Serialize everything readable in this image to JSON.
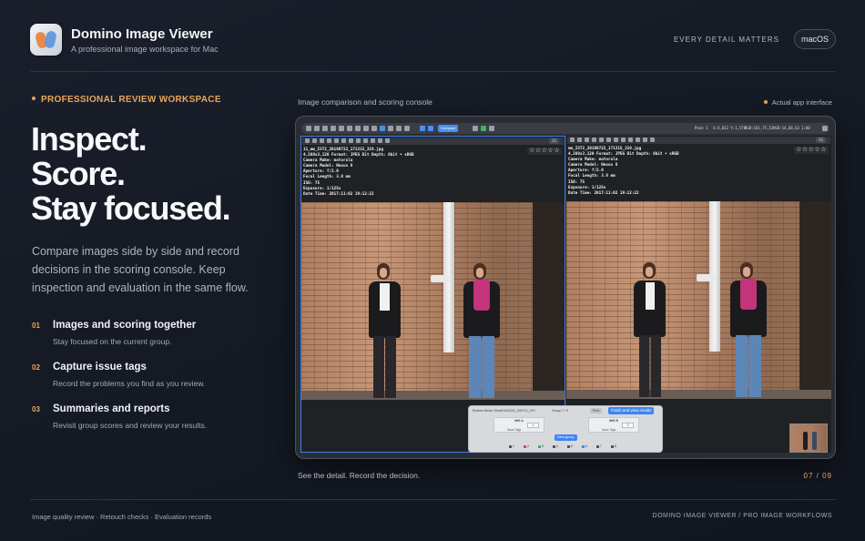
{
  "header": {
    "app_title": "Domino Image Viewer",
    "app_subtitle": "A professional image workspace for Mac",
    "tagline": "EVERY DETAIL MATTERS",
    "os_badge": "macOS"
  },
  "hero": {
    "eyebrow": "PROFESSIONAL REVIEW WORKSPACE",
    "lines": [
      "Inspect.",
      "Score.",
      "Stay focused."
    ],
    "lede": "Compare images side by side and record decisions in the scoring console. Keep inspection and evaluation in the same flow."
  },
  "features": [
    {
      "num": "01",
      "title": "Images and scoring together",
      "desc": "Stay focused on the current group."
    },
    {
      "num": "02",
      "title": "Capture issue tags",
      "desc": "Record the problems you find as you review."
    },
    {
      "num": "03",
      "title": "Summaries and reports",
      "desc": "Revisit group scores and review your results."
    }
  ],
  "showcase": {
    "label": "Image comparison and scoring console",
    "actual_label": "Actual app interface",
    "caption": "See the detail. Record the decision.",
    "pager": "07 / 09"
  },
  "app": {
    "toolbar_button": "Compare",
    "readout_pane": "Pane 1",
    "readout_coords": "X:4,032 Y:1,576",
    "readout_rgb": "RGB:161,75,52",
    "readout_hsb": "HSB:14,68,63",
    "readout_zoom": "1:00",
    "zoom_level": "31",
    "left_meta": [
      "11_mm_IST2_20160722_171315_319.jpg",
      "4,288x3,120  Format: JPEG  Bit Depth: 8bit • sRGB",
      "Camera Make: motorola",
      "Camera Model: Nexus 6",
      "Aperture: f/2.0",
      "Focal Length: 3.8 mm",
      "ISO: 75",
      "Exposure: 1/125s",
      "Date Time: 2017:11:02 19:12:22"
    ],
    "right_meta": [
      "mm_IST2_20160722_171315_319.jpg",
      "4,288x3,120  Format: JPEG  Bit Depth: 8bit • sRGB",
      "Camera Make: motorola",
      "Camera Model: Nexus 6",
      "Aperture: f/2.0",
      "Focal Length: 3.8 mm",
      "ISO: 75",
      "Exposure: 1/125s",
      "Date Time: 2017:11:02 19:12:22"
    ],
    "stars": "☆☆☆☆☆",
    "score_panel": {
      "header": "Review Mode  Ohm20161022_155712_019",
      "group": "Group 7 / 9",
      "prev": "Prev",
      "finish": "Finish and view results",
      "card_left_label": "IMG A",
      "card_left_value": "0",
      "card_left_tags": "Issue Tags",
      "card_right_label": "IMG B",
      "card_right_value": "0",
      "card_right_tags": "Issue Tags",
      "next_group": "Next group",
      "dots": [
        "1",
        "2",
        "3",
        "4",
        "5",
        "6",
        "7",
        "8"
      ]
    }
  },
  "footer": {
    "left": "Image quality review · Retouch checks · Evaluation records",
    "right": "DOMINO IMAGE VIEWER / PRO IMAGE WORKFLOWS"
  },
  "colors": {
    "accent": "#e9a55a",
    "selection_blue": "#3d7fe6",
    "background": "#151a24"
  }
}
